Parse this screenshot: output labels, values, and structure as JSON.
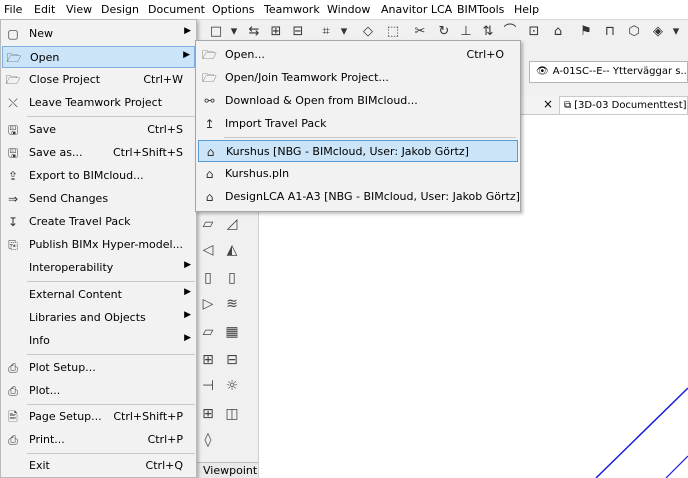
{
  "menubar": [
    "File",
    "Edit",
    "View",
    "Design",
    "Document",
    "Options",
    "Teamwork",
    "Window",
    "Anavitor LCA",
    "BIMTools",
    "Help"
  ],
  "file_menu": {
    "items": [
      {
        "label": "New",
        "shortcut": "",
        "submenu": true,
        "icon": "new-file-icon"
      },
      {
        "label": "Open",
        "shortcut": "",
        "submenu": true,
        "icon": "open-folder-icon",
        "highlighted": true
      },
      {
        "label": "Close Project",
        "shortcut": "Ctrl+W",
        "icon": "close-project-icon"
      },
      {
        "label": "Leave Teamwork Project",
        "shortcut": "",
        "icon": "leave-teamwork-icon"
      },
      {
        "label": "Save",
        "shortcut": "Ctrl+S",
        "icon": "save-icon"
      },
      {
        "label": "Save as...",
        "shortcut": "Ctrl+Shift+S",
        "icon": "save-as-icon"
      },
      {
        "label": "Export to BIMcloud...",
        "shortcut": "",
        "icon": "export-bimcloud-icon"
      },
      {
        "label": "Send Changes",
        "shortcut": "",
        "icon": "send-changes-icon"
      },
      {
        "label": "Create Travel Pack",
        "shortcut": "",
        "icon": "travel-pack-icon"
      },
      {
        "label": "Publish BIMx Hyper-model...",
        "shortcut": "",
        "icon": "bimx-icon"
      },
      {
        "label": "Interoperability",
        "shortcut": "",
        "submenu": true
      },
      {
        "label": "External Content",
        "shortcut": "",
        "submenu": true
      },
      {
        "label": "Libraries and Objects",
        "shortcut": "",
        "submenu": true
      },
      {
        "label": "Info",
        "shortcut": "",
        "submenu": true
      },
      {
        "label": "Plot Setup...",
        "shortcut": "",
        "icon": "plot-setup-icon"
      },
      {
        "label": "Plot...",
        "shortcut": "",
        "icon": "plot-icon"
      },
      {
        "label": "Page Setup...",
        "shortcut": "Ctrl+Shift+P",
        "icon": "page-setup-icon"
      },
      {
        "label": "Print...",
        "shortcut": "Ctrl+P",
        "icon": "print-icon"
      },
      {
        "label": "Exit",
        "shortcut": "Ctrl+Q",
        "icon": "exit-icon"
      }
    ]
  },
  "open_submenu": {
    "items": [
      {
        "label": "Open...",
        "shortcut": "Ctrl+O",
        "icon": "open-folder-icon"
      },
      {
        "label": "Open/Join Teamwork Project...",
        "shortcut": "",
        "icon": "teamwork-open-icon"
      },
      {
        "label": "Download & Open from BIMcloud...",
        "shortcut": "",
        "icon": "bimcloud-download-icon"
      },
      {
        "label": "Import Travel Pack",
        "shortcut": "",
        "icon": "import-travel-pack-icon"
      },
      {
        "label": "Kurshus [NBG - BIMcloud, User: Jakob Görtz]",
        "shortcut": "",
        "icon": "house-icon",
        "highlighted": true
      },
      {
        "label": "Kurshus.pln",
        "shortcut": "",
        "icon": "house-icon"
      },
      {
        "label": "DesignLCA A1-A3 [NBG - BIMcloud, User: Jakob Görtz]",
        "shortcut": "",
        "icon": "house-icon"
      }
    ]
  },
  "view_selector": "A-01SC--E-- Ytterväggar s...",
  "active_tab": "[3D-03 Documenttest]",
  "tab_close": "×",
  "toolbox_footer": "Viewpoint"
}
